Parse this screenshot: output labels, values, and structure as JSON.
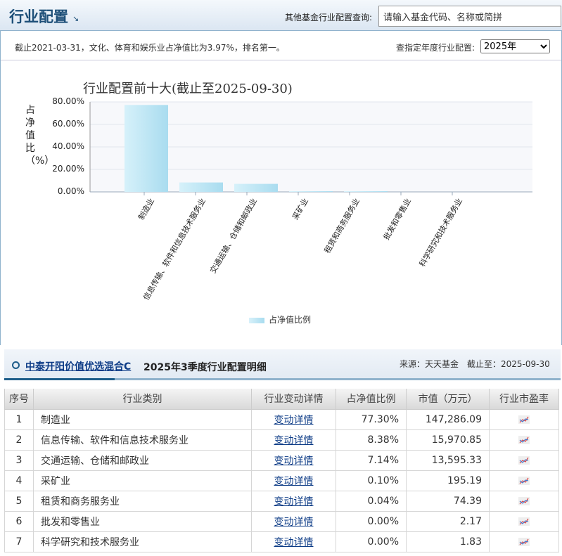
{
  "header": {
    "title": "行业配置",
    "query_label": "其他基金行业配置查询:",
    "search_placeholder": "请输入基金代码、名称或简拼"
  },
  "info": {
    "summary": "截止2021-03-31，文化、体育和娱乐业占净值比为3.97%，排名第一。",
    "year_label": "查指定年度行业配置:",
    "year_value": "2025年"
  },
  "chart_data": {
    "type": "bar",
    "title": "行业配置前十大(截止至2025-09-30)",
    "ylabel": "占净值比（%）",
    "ylim": [
      0,
      80
    ],
    "yticks": [
      "0.00%",
      "20.00%",
      "40.00%",
      "60.00%",
      "80.00%"
    ],
    "categories": [
      "制造业",
      "信息传输、软件和信息技术服务业",
      "交通运输、仓储和邮政业",
      "采矿业",
      "租赁和商务服务业",
      "批发和零售业",
      "科学研究和技术服务业"
    ],
    "values": [
      77.3,
      8.38,
      7.14,
      0.1,
      0.04,
      0.0,
      0.0
    ],
    "legend": "占净值比例",
    "color": "#b3e2f2"
  },
  "section": {
    "fund_name": "中泰开阳价值优选混合C",
    "subtitle": "2025年3季度行业配置明细",
    "source": "来源：天天基金　截止至：2025-09-30"
  },
  "table": {
    "headers": [
      "序号",
      "行业类别",
      "行业变动详情",
      "占净值比例",
      "市值（万元）",
      "行业市盈率"
    ],
    "rows": [
      [
        "1",
        "制造业",
        "变动详情",
        "77.30%",
        "147,286.09"
      ],
      [
        "2",
        "信息传输、软件和信息技术服务业",
        "变动详情",
        "8.38%",
        "15,970.85"
      ],
      [
        "3",
        "交通运输、仓储和邮政业",
        "变动详情",
        "7.14%",
        "13,595.33"
      ],
      [
        "4",
        "采矿业",
        "变动详情",
        "0.10%",
        "195.19"
      ],
      [
        "5",
        "租赁和商务服务业",
        "变动详情",
        "0.04%",
        "74.39"
      ],
      [
        "6",
        "批发和零售业",
        "变动详情",
        "0.00%",
        "2.17"
      ],
      [
        "7",
        "科学研究和技术服务业",
        "变动详情",
        "0.00%",
        "1.83"
      ]
    ]
  }
}
